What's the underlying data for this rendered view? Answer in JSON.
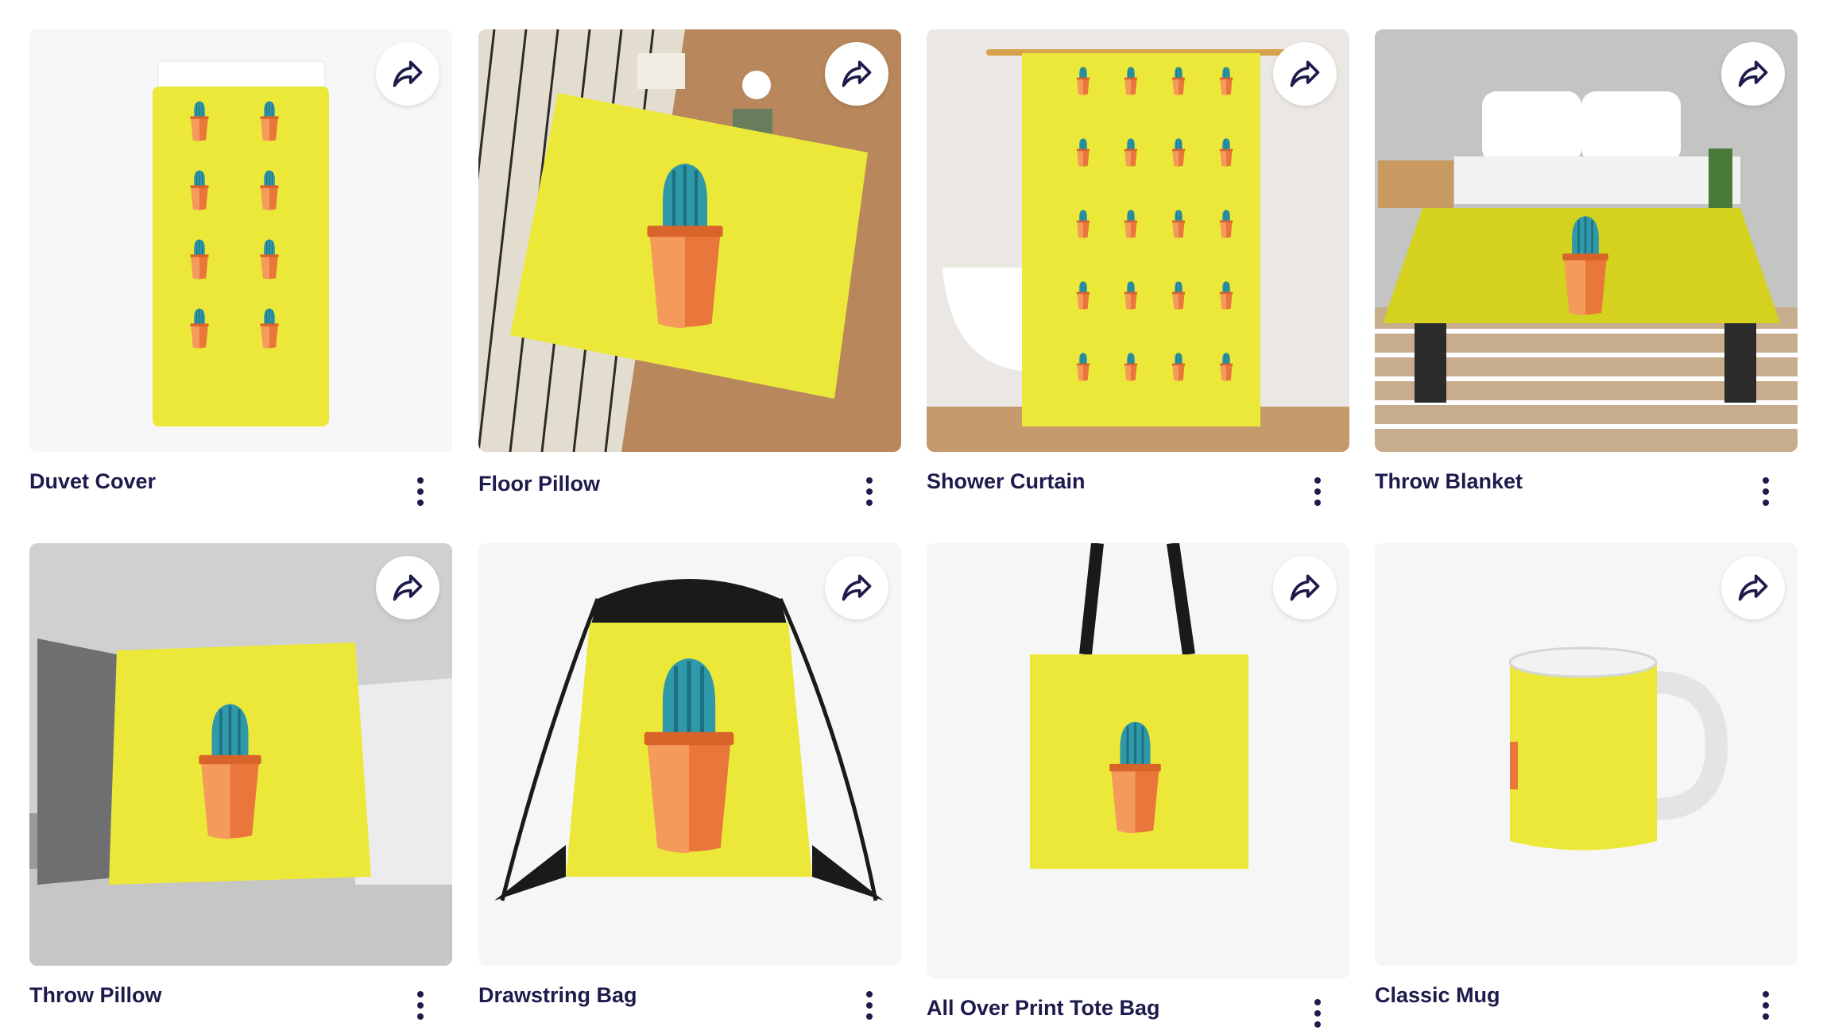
{
  "colors": {
    "accent_yellow": "#ece83a",
    "pot_orange": "#e9763a",
    "cactus_teal": "#2f98a9",
    "text": "#1d1b4c"
  },
  "products": [
    {
      "title": "Duvet Cover",
      "share_icon": "share-arrow-icon",
      "more_icon": "more-vertical-icon"
    },
    {
      "title": "Floor Pillow",
      "share_icon": "share-arrow-icon",
      "more_icon": "more-vertical-icon"
    },
    {
      "title": "Shower Curtain",
      "share_icon": "share-arrow-icon",
      "more_icon": "more-vertical-icon"
    },
    {
      "title": "Throw Blanket",
      "share_icon": "share-arrow-icon",
      "more_icon": "more-vertical-icon"
    },
    {
      "title": "Throw Pillow",
      "share_icon": "share-arrow-icon",
      "more_icon": "more-vertical-icon"
    },
    {
      "title": "Drawstring Bag",
      "share_icon": "share-arrow-icon",
      "more_icon": "more-vertical-icon"
    },
    {
      "title": "All Over Print Tote Bag",
      "share_icon": "share-arrow-icon",
      "more_icon": "more-vertical-icon"
    },
    {
      "title": "Classic Mug",
      "share_icon": "share-arrow-icon",
      "more_icon": "more-vertical-icon"
    }
  ]
}
